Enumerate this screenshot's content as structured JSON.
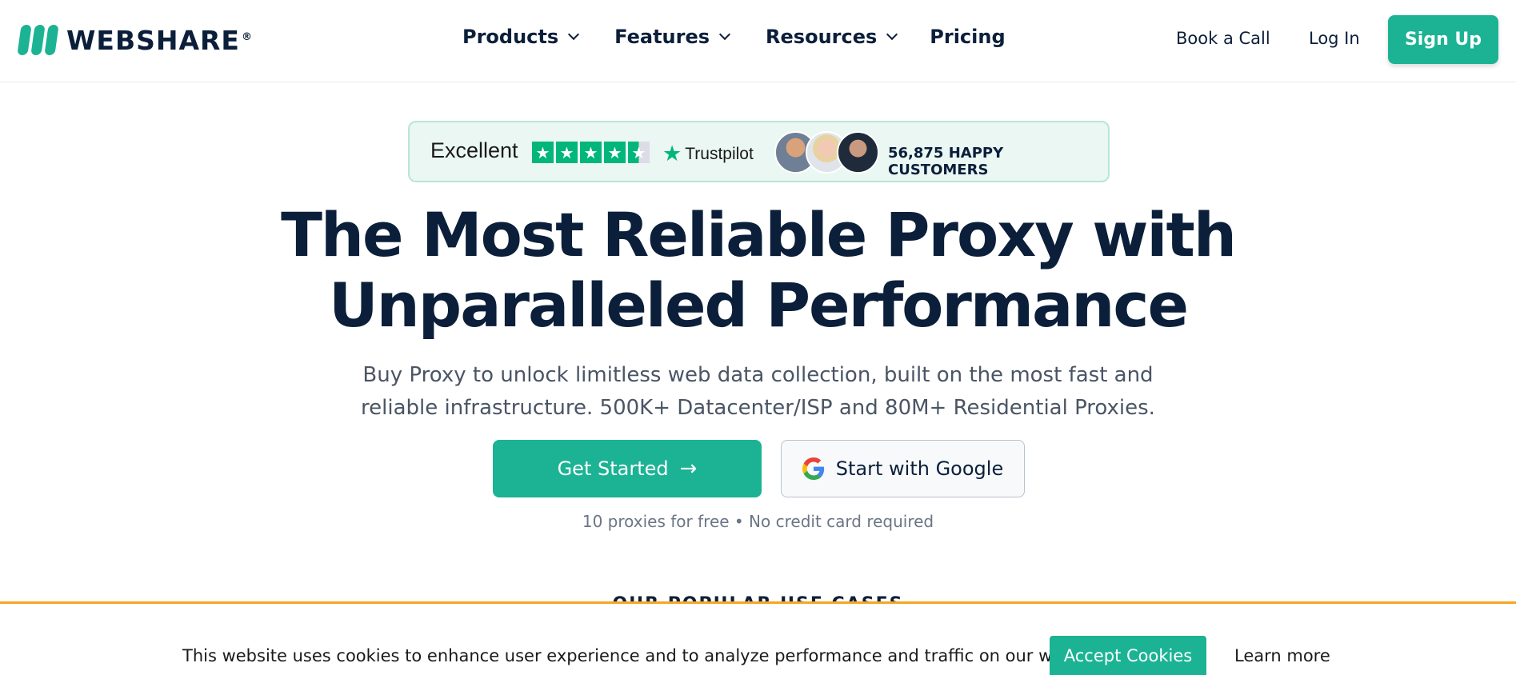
{
  "brand": {
    "name": "WEBSHARE",
    "reg": "®",
    "color": "#1bb394"
  },
  "nav": {
    "items": [
      {
        "label": "Products",
        "has_dropdown": true
      },
      {
        "label": "Features",
        "has_dropdown": true
      },
      {
        "label": "Resources",
        "has_dropdown": true
      },
      {
        "label": "Pricing",
        "has_dropdown": false
      }
    ],
    "book_call": "Book a Call",
    "login": "Log In",
    "signup": "Sign Up"
  },
  "trust": {
    "excellent": "Excellent",
    "rating_stars": 4.5,
    "trustpilot": "Trustpilot",
    "happy_customers": "56,875 HAPPY CUSTOMERS"
  },
  "hero": {
    "title_line1": "The Most Reliable Proxy with",
    "title_line2": "Unparalleled Performance",
    "subtitle_line1": "Buy Proxy to unlock limitless web data collection, built on the most fast and",
    "subtitle_line2": "reliable infrastructure. 500K+ Datacenter/ISP and 80M+ Residential Proxies.",
    "get_started": "Get Started",
    "google": "Start with Google",
    "free_note": "10 proxies for free • No credit card required"
  },
  "section_peek": "OUR POPULAR USE CASES",
  "cookie": {
    "text": "This website uses cookies to enhance user experience and to analyze performance and traffic on our website.",
    "accept": "Accept Cookies",
    "learn_more": "Learn more"
  }
}
